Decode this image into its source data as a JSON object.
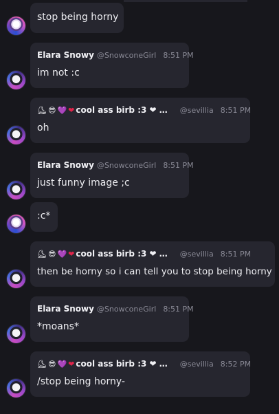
{
  "messages": [
    {
      "text": "stop being horny"
    },
    {
      "name": "Elara Snowy",
      "handle": "@SnowconeGirl",
      "time": "8:51 PM",
      "text": "im not :c"
    },
    {
      "emojis": [
        "⛸",
        "😎",
        "💜",
        "❤"
      ],
      "name": "cool ass birb :3 ❤ …",
      "handle": "@sevillia",
      "time": "8:51 PM",
      "text": "oh"
    },
    {
      "name": "Elara Snowy",
      "handle": "@SnowconeGirl",
      "time": "8:51 PM",
      "text": "just funny image ;c"
    },
    {
      "text": ":c*"
    },
    {
      "emojis": [
        "⛸",
        "😎",
        "💜",
        "❤"
      ],
      "name": "cool ass birb :3 ❤ …",
      "handle": "@sevillia",
      "time": "8:51 PM",
      "text": "then be horny so i can tell you to stop being horny"
    },
    {
      "name": "Elara Snowy",
      "handle": "@SnowconeGirl",
      "time": "8:51 PM",
      "text": "*moans*"
    },
    {
      "emojis": [
        "⛸",
        "😎",
        "💜",
        "❤"
      ],
      "name": "cool ass birb :3 ❤ …",
      "handle": "@sevillia",
      "time": "8:52 PM",
      "text": "/stop being horny-"
    }
  ]
}
